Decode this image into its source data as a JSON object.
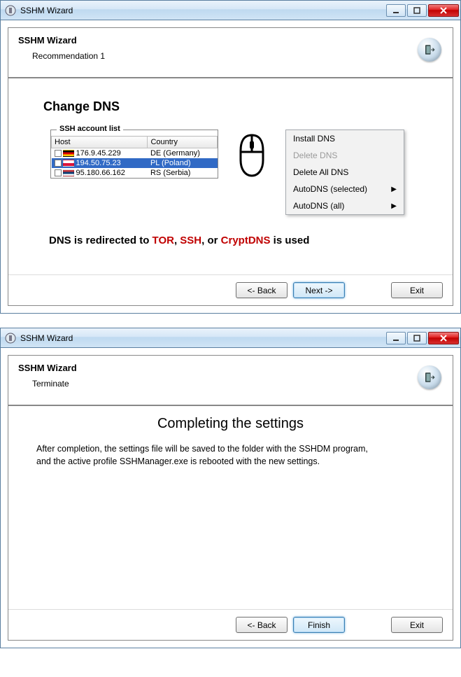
{
  "window1": {
    "title": "SSHM Wizard",
    "header_title": "SSHM Wizard",
    "header_sub": "Recommendation 1",
    "section_title": "Change DNS",
    "ssh_group_legend": "SSH account list",
    "columns": {
      "host": "Host",
      "country": "Country"
    },
    "rows": [
      {
        "flag": "de",
        "host": "176.9.45.229",
        "country": "DE (Germany)",
        "selected": false
      },
      {
        "flag": "pl",
        "host": "194.50.75.23",
        "country": "PL (Poland)",
        "selected": true
      },
      {
        "flag": "rs",
        "host": "95.180.66.162",
        "country": "RS (Serbia)",
        "selected": false
      }
    ],
    "menu": {
      "install": "Install DNS",
      "delete": "Delete DNS",
      "delete_all": "Delete All DNS",
      "auto_sel": "AutoDNS (selected)",
      "auto_all": "AutoDNS (all)"
    },
    "statement_prefix": "DNS is redirected to ",
    "statement_tor": "TOR",
    "statement_sep1": ", ",
    "statement_ssh": "SSH",
    "statement_sep2": ", or ",
    "statement_crypt": "CryptDNS",
    "statement_suffix": " is used",
    "buttons": {
      "back": "<- Back",
      "next": "Next ->",
      "exit": "Exit"
    }
  },
  "window2": {
    "title": "SSHM Wizard",
    "header_title": "SSHM Wizard",
    "header_sub": "Terminate",
    "complete_title": "Completing the settings",
    "complete_text_l1": "After completion, the settings file will be saved to the folder with the SSHDM program,",
    "complete_text_l2": "and the active profile SSHManager.exe is rebooted with the new settings.",
    "buttons": {
      "back": "<- Back",
      "finish": "Finish",
      "exit": "Exit"
    }
  }
}
